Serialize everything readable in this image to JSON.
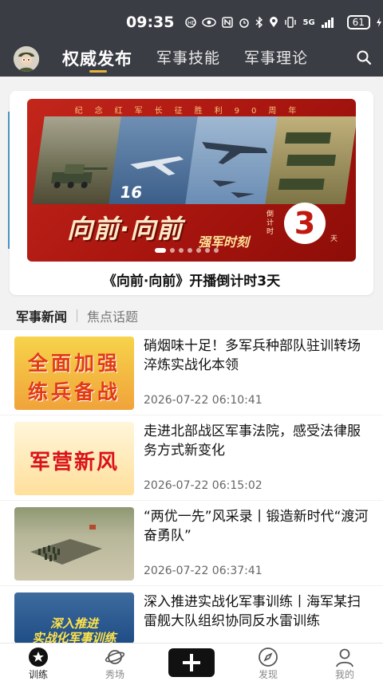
{
  "status_bar": {
    "time": "09:35",
    "icons": [
      "hd-icon",
      "eye-icon",
      "nfc-icon",
      "alarm-icon",
      "bluetooth-icon",
      "location-icon",
      "vibrate-icon",
      "signal-icon"
    ],
    "network": "5G",
    "battery": "61"
  },
  "header": {
    "tabs": [
      {
        "label": "权威发布",
        "active": true
      },
      {
        "label": "军事技能",
        "active": false
      },
      {
        "label": "军事理论",
        "active": false
      }
    ]
  },
  "banner": {
    "top_line": "纪念红军长征胜利90周年",
    "headline": "向前·向前",
    "subtitle": "强军时刻",
    "countdown_label": "倒计时",
    "countdown_number": "3",
    "countdown_unit": "天",
    "caption": "《向前·向前》开播倒计时3天",
    "dots": 7,
    "active_dot": 0
  },
  "section_tabs": [
    {
      "label": "军事新闻",
      "active": true
    },
    {
      "label": "焦点话题",
      "active": false
    }
  ],
  "news": [
    {
      "title": "硝烟味十足！多军兵种部队驻训转场淬炼实战化本领",
      "date": "2026-07-22 06:10:41",
      "thumb_text": [
        "全面加强",
        "练兵备战"
      ]
    },
    {
      "title": "走进北部战区军事法院，感受法律服务方式新变化",
      "date": "2026-07-22 06:15:02",
      "thumb_text": [
        "军营新风"
      ]
    },
    {
      "title": "“两优一先”风采录丨锻造新时代“渡河奋勇队”",
      "date": "2026-07-22 06:37:41",
      "thumb_text": []
    },
    {
      "title": "深入推进实战化军事训练丨海军某扫雷舰大队组织协同反水雷训练",
      "date": "",
      "thumb_text": [
        "深入推进",
        "实战化军事训练"
      ]
    }
  ],
  "bottom_nav": [
    {
      "label": "训练",
      "icon": "star-badge-icon",
      "active": true
    },
    {
      "label": "秀场",
      "icon": "planet-icon",
      "active": false
    },
    {
      "label": "",
      "icon": "plus-icon",
      "active": false
    },
    {
      "label": "发现",
      "icon": "compass-icon",
      "active": false
    },
    {
      "label": "我的",
      "icon": "person-icon",
      "active": false
    }
  ],
  "colors": {
    "header_bg": "#3a3d44",
    "tab_indicator": "#e6b43c",
    "banner_red": "#c3261b"
  }
}
